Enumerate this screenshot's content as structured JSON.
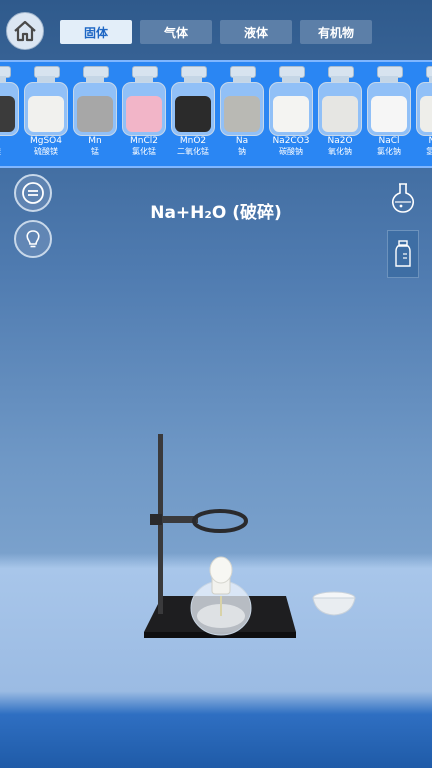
{
  "tabs": [
    {
      "label": "固体",
      "active": true
    },
    {
      "label": "气体",
      "active": false
    },
    {
      "label": "液体",
      "active": false
    },
    {
      "label": "有机物",
      "active": false
    }
  ],
  "shelf": {
    "items": [
      {
        "formula": "O",
        "name": "镁",
        "color": "#3b3b3b"
      },
      {
        "formula": "MgSO4",
        "name": "硫酸镁",
        "color": "#f1f1ee"
      },
      {
        "formula": "Mn",
        "name": "锰",
        "color": "#a7a7a7"
      },
      {
        "formula": "MnCl2",
        "name": "氯化锰",
        "color": "#f2b5c8"
      },
      {
        "formula": "MnO2",
        "name": "二氧化锰",
        "color": "#2b2b2b"
      },
      {
        "formula": "Na",
        "name": "钠",
        "color": "#b9b9b4"
      },
      {
        "formula": "Na2CO3",
        "name": "碳酸钠",
        "color": "#f4f4f2"
      },
      {
        "formula": "Na2O",
        "name": "氧化钠",
        "color": "#e6e6e3"
      },
      {
        "formula": "NaCl",
        "name": "氯化钠",
        "color": "#f6f6f6"
      },
      {
        "formula": "NaH",
        "name": "氢化钠",
        "color": "#eeeeea"
      }
    ]
  },
  "experiment": {
    "title": "Na+H₂O (破碎)"
  },
  "icons": {
    "home": "home-icon",
    "menu": "menu-icon",
    "hint": "lightbulb-icon",
    "flask": "flask-icon",
    "bottle": "bottle-icon"
  },
  "colors": {
    "shelf": "#2a86f3",
    "tab_active_text": "#1d66c4",
    "tab_inactive": "#5c7fa8"
  }
}
